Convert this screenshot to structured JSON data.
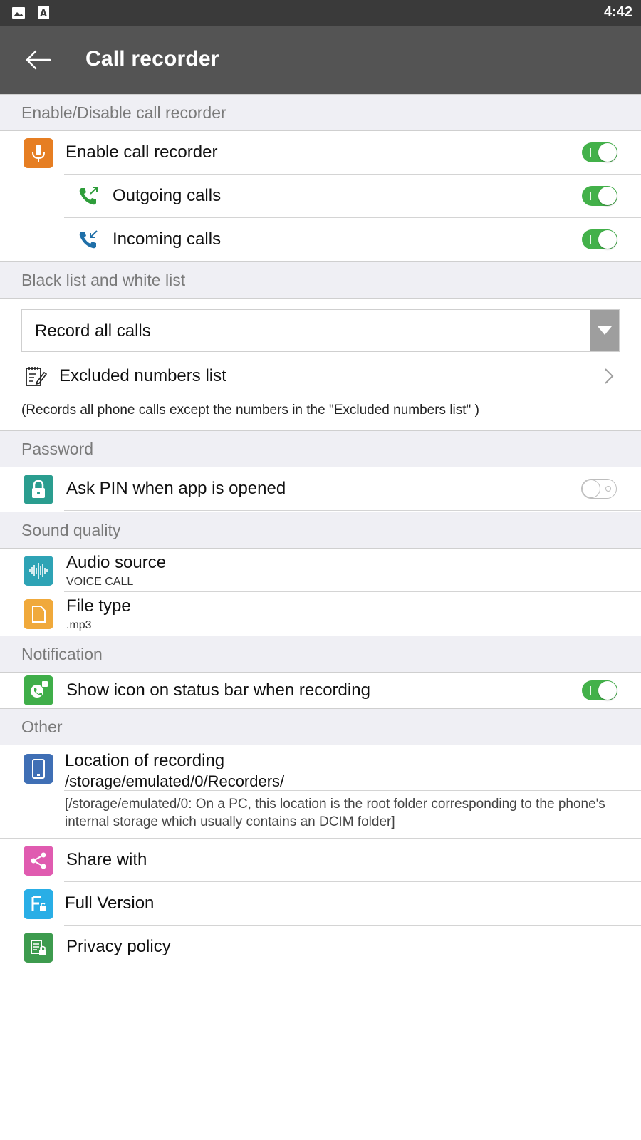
{
  "status_bar": {
    "time": "4:42",
    "icons": [
      "image-icon",
      "a-keyboard-icon"
    ]
  },
  "toolbar": {
    "title": "Call recorder",
    "back_icon": "arrow-back-icon"
  },
  "sections": {
    "enable": {
      "header": "Enable/Disable call recorder",
      "enable_label": "Enable call recorder",
      "outgoing_label": "Outgoing calls",
      "incoming_label": "Incoming calls",
      "enable_on": true,
      "outgoing_on": true,
      "incoming_on": true
    },
    "lists": {
      "header": "Black list and white list",
      "selected_mode": "Record all calls",
      "excluded_label": "Excluded numbers list",
      "note": "(Records all phone calls except the numbers in the \"Excluded numbers list\" )"
    },
    "password": {
      "header": "Password",
      "pin_label": "Ask PIN when app is opened",
      "pin_on": false
    },
    "sound": {
      "header": "Sound quality",
      "audio_label": "Audio source",
      "audio_value": "VOICE CALL",
      "file_label": "File type",
      "file_value": ".mp3"
    },
    "notification": {
      "header": "Notification",
      "status_icon_label": "Show icon on status bar when recording",
      "status_icon_on": true
    },
    "other": {
      "header": "Other",
      "location_label": "Location of recording",
      "location_path": "/storage/emulated/0/Recorders/",
      "location_desc_1": "[/storage/emulated/0: On a PC, this location is the root folder corresponding to the phone's",
      "location_desc_2": "internal storage which usually contains an DCIM folder]",
      "share_label": "Share with",
      "full_label": "Full Version",
      "privacy_label": "Privacy policy"
    }
  },
  "colors": {
    "toolbar": "#545454",
    "status_bar": "#3a3a3a",
    "toggle_on": "#43b14a",
    "mic_icon": "#e67e22",
    "lock_icon": "#2a9d8f",
    "audio_icon": "#2ea3b5",
    "file_icon": "#f0a93b",
    "notify_icon": "#3fae49",
    "location_icon": "#3f6fb5",
    "share_icon": "#e05bb0",
    "full_icon": "#29aee6",
    "privacy_icon": "#3d9b4e"
  }
}
